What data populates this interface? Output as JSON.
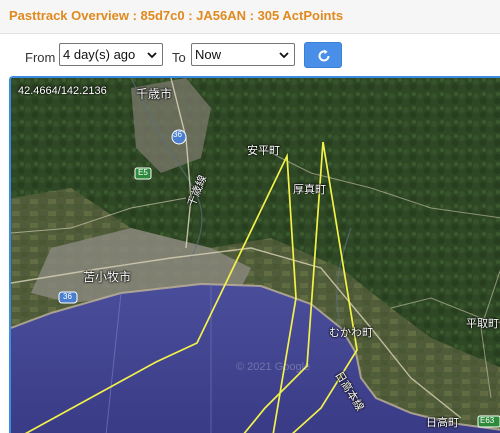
{
  "header": {
    "title": "Pasttrack Overview : 85d7c0 : JA56AN : 305 ActPoints"
  },
  "controls": {
    "from_label": "From",
    "from_value": "4 day(s) ago",
    "to_label": "To",
    "to_value": "Now"
  },
  "map": {
    "coordinate_readout": "42.4664/142.2136",
    "places": {
      "chitose": "千歳市",
      "abira": "安平町",
      "atsuma": "厚真町",
      "tomakomai": "苫小牧市",
      "mukawa": "むかわ町",
      "hidaka_line": "日高本線",
      "biratori": "平取町",
      "hidaka": "日高町",
      "route_chitose": "千歳線",
      "e5": "E5",
      "e63": "E63",
      "r36a": "36",
      "r36b": "36",
      "watermark": "© 2021 Google"
    },
    "track_color": "#f2f24a"
  }
}
